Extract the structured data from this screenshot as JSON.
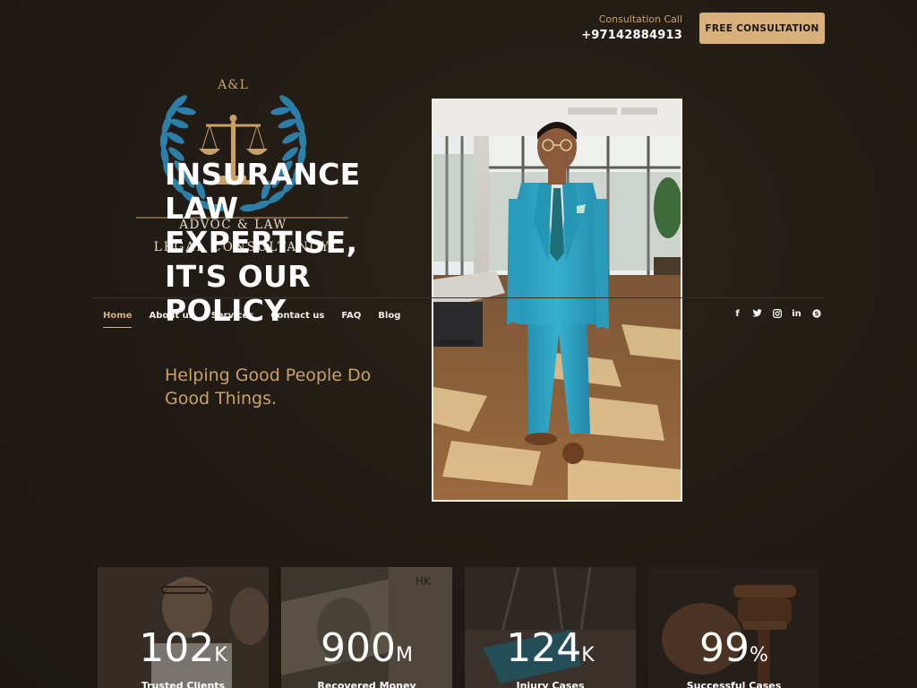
{
  "header": {
    "consult_label": "Consultation Call",
    "phone": "+97142884913",
    "cta_label": "FREE CONSULTATION"
  },
  "logo": {
    "brand": "A&L",
    "line1": "ADVOC & LAW",
    "line2": "LEGAL CONSULTANCY",
    "icon": "scales-of-justice-icon"
  },
  "hero": {
    "headline": "INSURANCE LAW EXPERTISE, IT'S OUR POLICY",
    "subhead": "Helping Good People Do Good Things."
  },
  "nav": {
    "items": [
      {
        "label": "Home",
        "active": true
      },
      {
        "label": "About us"
      },
      {
        "label": "Services"
      },
      {
        "label": "Contact us"
      },
      {
        "label": "FAQ"
      },
      {
        "label": "Blog"
      }
    ]
  },
  "social": [
    {
      "icon": "facebook-icon",
      "glyph": "f"
    },
    {
      "icon": "twitter-icon",
      "glyph": "t"
    },
    {
      "icon": "instagram-icon",
      "glyph": "◎"
    },
    {
      "icon": "linkedin-icon",
      "glyph": "in"
    },
    {
      "icon": "skype-icon",
      "glyph": "s"
    }
  ],
  "stats": [
    {
      "number": "102",
      "suffix": "K",
      "label": "Trusted Clients"
    },
    {
      "number": "900",
      "suffix": "M",
      "label": "Recovered Money"
    },
    {
      "number": "124",
      "suffix": "K",
      "label": "Injury Cases"
    },
    {
      "number": "99",
      "suffix": "%",
      "label": "Successful Cases"
    }
  ],
  "colors": {
    "accent": "#d9b07a",
    "gold_text": "#c9a26a",
    "background": "#221c16",
    "laurel": "#2c7fa8",
    "suit": "#2ea3c2"
  }
}
